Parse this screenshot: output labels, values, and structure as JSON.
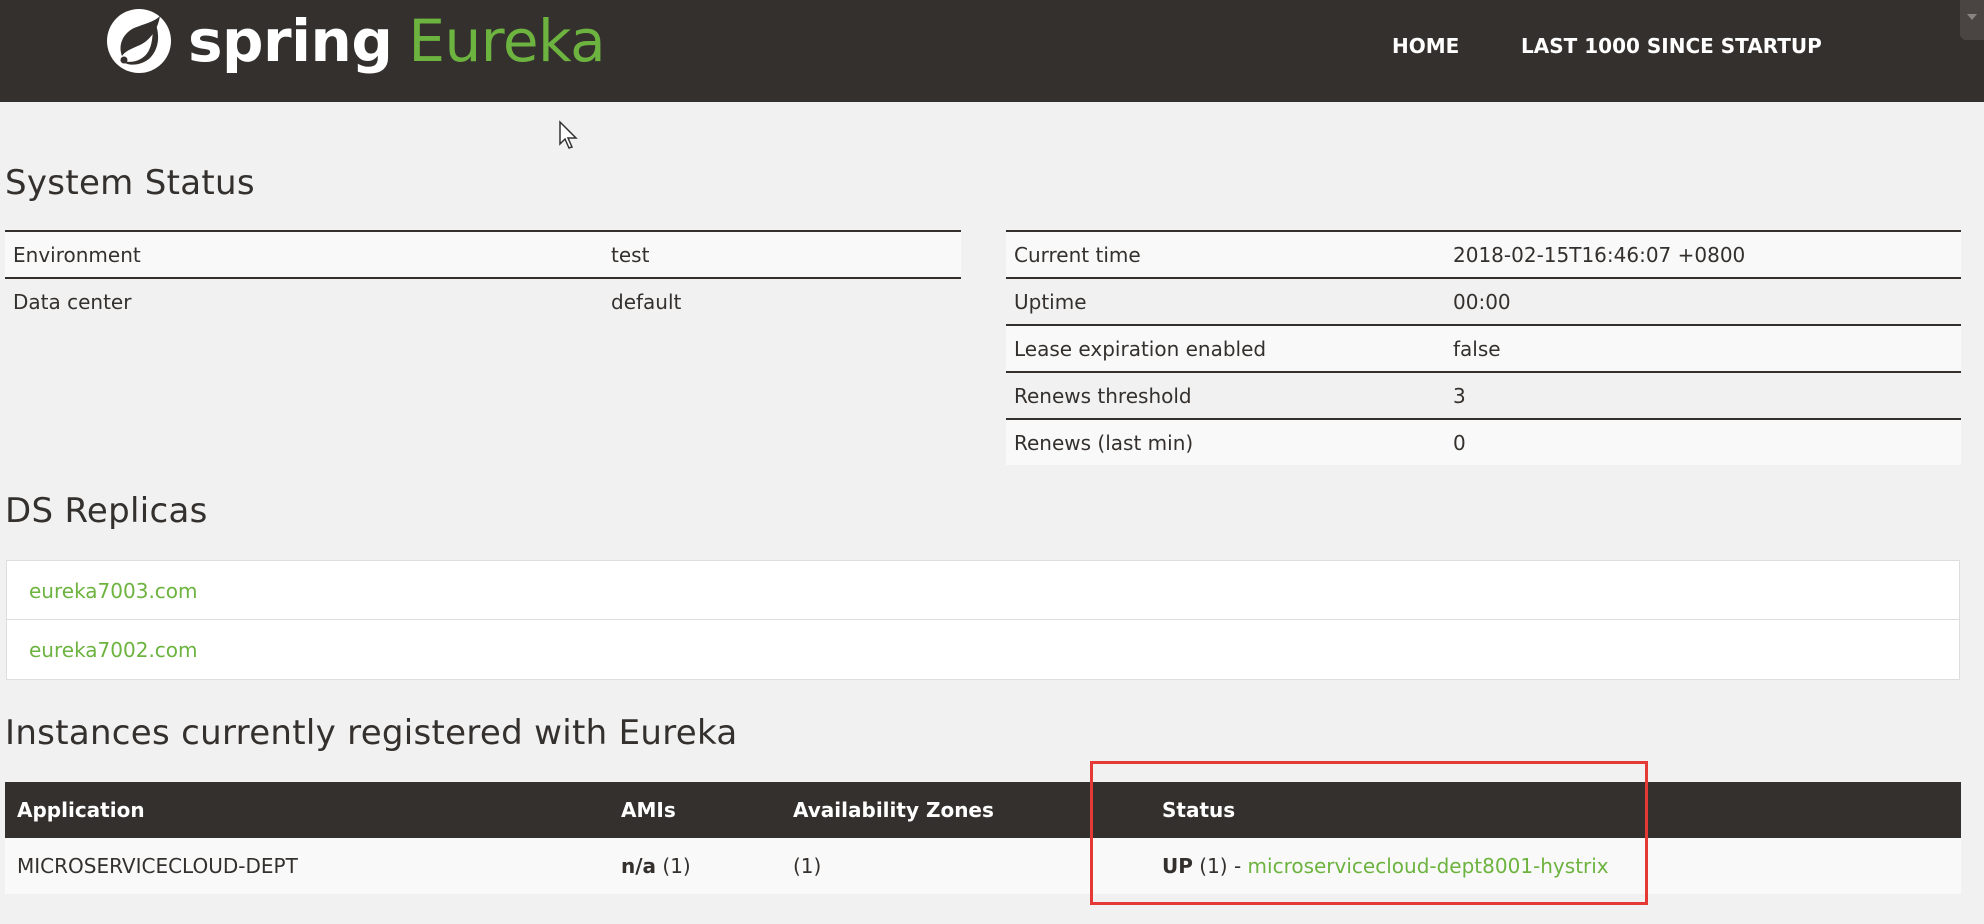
{
  "header": {
    "brand": {
      "spring": "spring",
      "eureka": "Eureka"
    },
    "nav": {
      "home": "HOME",
      "last": "LAST 1000 SINCE STARTUP"
    }
  },
  "system_status": {
    "title": "System Status",
    "left": [
      {
        "label": "Environment",
        "value": "test"
      },
      {
        "label": "Data center",
        "value": "default"
      }
    ],
    "right": [
      {
        "label": "Current time",
        "value": "2018-02-15T16:46:07 +0800"
      },
      {
        "label": "Uptime",
        "value": "00:00"
      },
      {
        "label": "Lease expiration enabled",
        "value": "false"
      },
      {
        "label": "Renews threshold",
        "value": "3"
      },
      {
        "label": "Renews (last min)",
        "value": "0"
      }
    ]
  },
  "replicas": {
    "title": "DS Replicas",
    "items": [
      "eureka7003.com",
      "eureka7002.com"
    ]
  },
  "instances": {
    "title": "Instances currently registered with Eureka",
    "columns": [
      "Application",
      "AMIs",
      "Availability Zones",
      "Status"
    ],
    "rows": [
      {
        "application": "MICROSERVICECLOUD-DEPT",
        "amis_bold": "n/a",
        "amis_count": "(1)",
        "zones": "(1)",
        "status_bold": "UP",
        "status_count": "(1) -",
        "status_link": "microservicecloud-dept8001-hystrix"
      }
    ]
  },
  "colors": {
    "header_bg": "#34302d",
    "brand_green": "#6db33f",
    "highlight": "#e53935"
  }
}
